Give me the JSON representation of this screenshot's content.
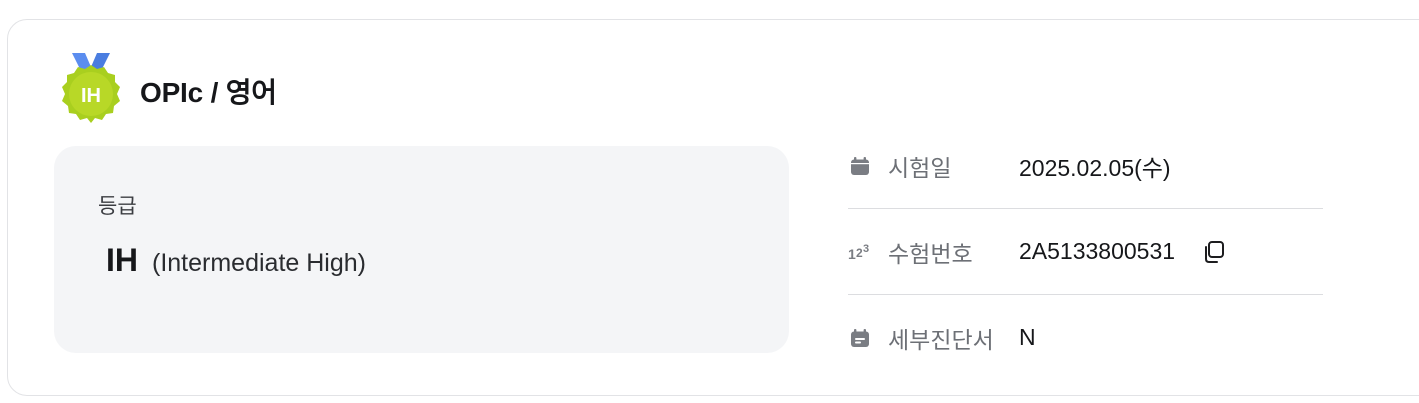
{
  "header": {
    "title": "OPIc / 영어",
    "medal_label": "IH",
    "medal_icon": "medal-icon",
    "colors": {
      "medal_ribbon": "#5b8def",
      "medal_body": "#a9cf1f"
    }
  },
  "grade": {
    "label": "등급",
    "code": "IH",
    "full": "(Intermediate High)"
  },
  "info": {
    "rows": [
      {
        "icon": "calendar-icon",
        "label": "시험일",
        "value": "2025.02.05(수)"
      },
      {
        "icon": "numbers-icon",
        "label": "수험번호",
        "value": "2A5133800531",
        "action_icon": "copy-icon"
      },
      {
        "icon": "calendar-check-icon",
        "label": "세부진단서",
        "value": "N"
      }
    ]
  },
  "colors": {
    "panel_bg": "#f4f5f7",
    "label": "#6d7076",
    "divider": "#dcdde0"
  }
}
